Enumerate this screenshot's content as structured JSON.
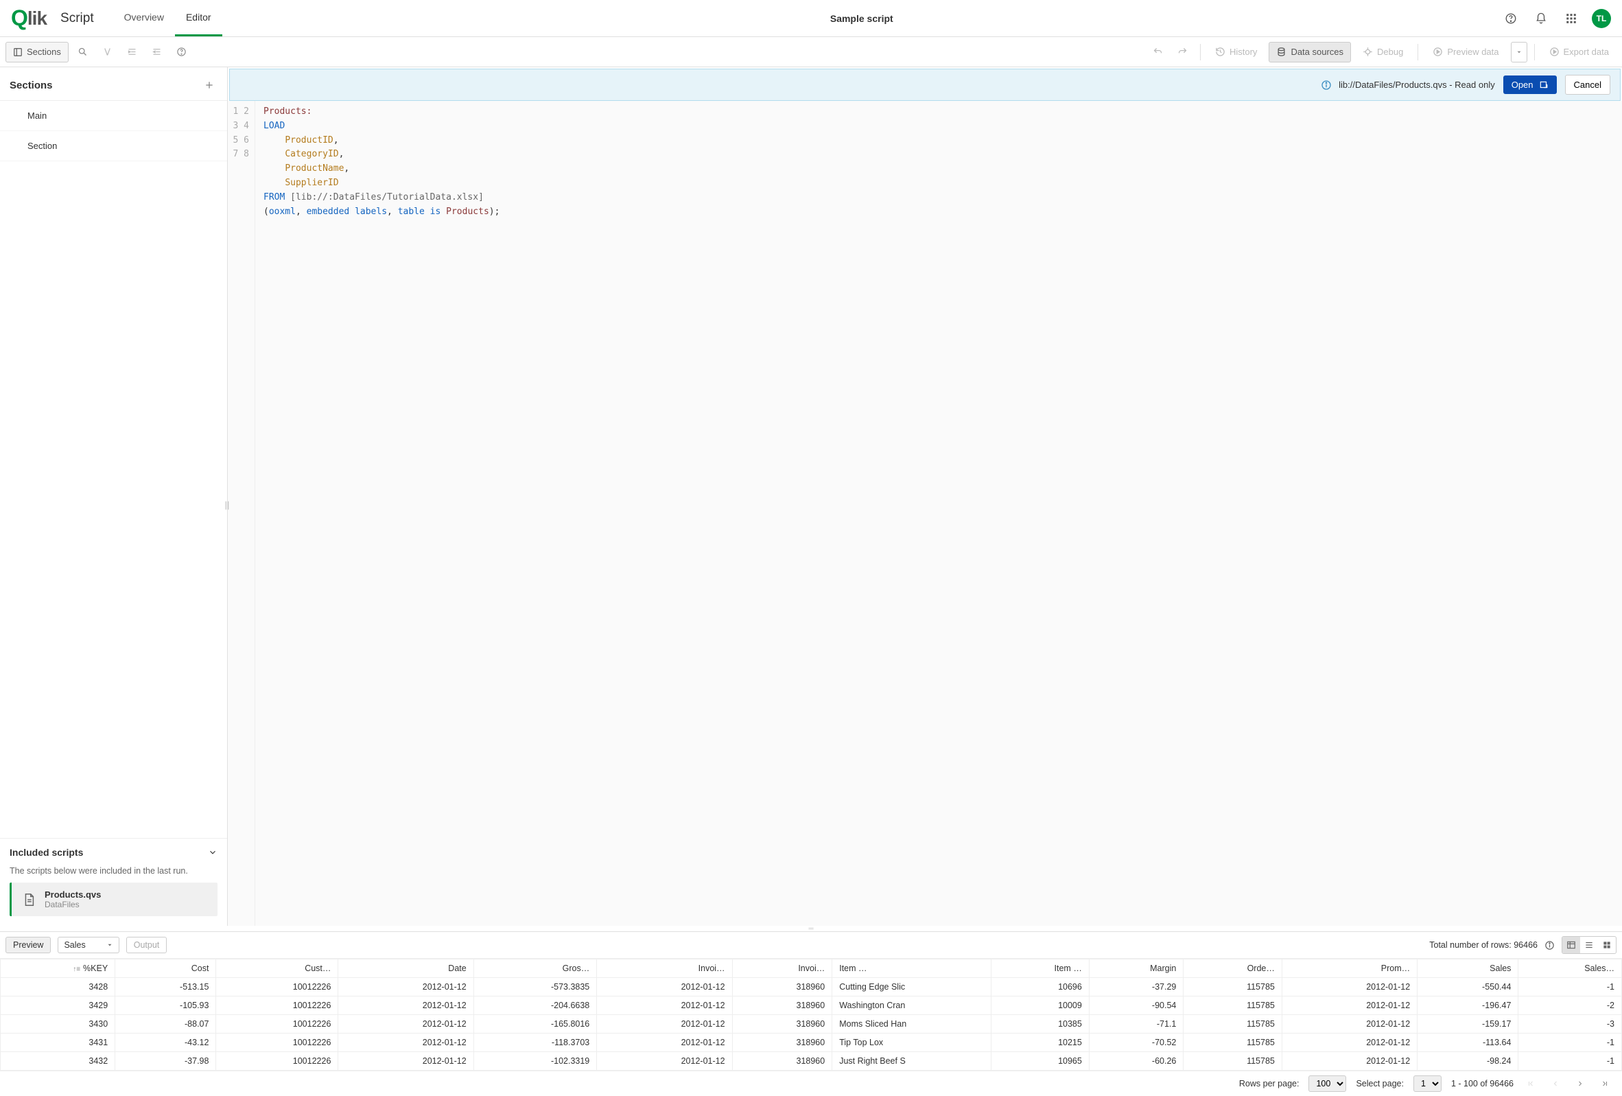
{
  "header": {
    "brand_prefix": "Q",
    "brand_rest": "lik",
    "script_label": "Script",
    "tabs": {
      "overview": "Overview",
      "editor": "Editor"
    },
    "title": "Sample script",
    "avatar": "TL"
  },
  "toolbar": {
    "sections": "Sections",
    "history": "History",
    "data_sources": "Data sources",
    "debug": "Debug",
    "preview_data": "Preview data",
    "export_data": "Export data"
  },
  "sidebar": {
    "title": "Sections",
    "items": [
      "Main",
      "Section"
    ],
    "included_title": "Included scripts",
    "included_desc": "The scripts below were included in the last run.",
    "script_name": "Products.qvs",
    "script_location": "DataFiles"
  },
  "notice": {
    "path": "lib://DataFiles/Products.qvs - Read only",
    "open": "Open",
    "cancel": "Cancel"
  },
  "code": {
    "lines": [
      "1",
      "2",
      "3",
      "4",
      "5",
      "6",
      "7",
      "8"
    ],
    "tbl": "Products:",
    "load": "LOAD",
    "f1": "ProductID",
    "f2": "CategoryID",
    "f3": "ProductName",
    "f4": "SupplierID",
    "from": "FROM",
    "path": "[lib://:DataFiles/TutorialData.xlsx]",
    "paren_open": "(",
    "ooxml": "ooxml",
    "embedded": "embedded",
    "labels": "labels",
    "table": "table",
    "is": "is",
    "products": "Products",
    "close": ");"
  },
  "preview": {
    "tab": "Preview",
    "dropdown": "Sales",
    "output": "Output",
    "total_label": "Total number of rows:",
    "total": "96466",
    "columns": [
      "%KEY",
      "Cost",
      "Cust…",
      "Date",
      "Gros…",
      "Invoi…",
      "Invoi…",
      "Item …",
      "Item …",
      "Margin",
      "Orde…",
      "Prom…",
      "Sales",
      "Sales…"
    ],
    "rows": [
      [
        "3428",
        "-513.15",
        "10012226",
        "2012-01-12",
        "-573.3835",
        "2012-01-12",
        "318960",
        "Cutting Edge Slic",
        "10696",
        "-37.29",
        "115785",
        "2012-01-12",
        "-550.44",
        "-1"
      ],
      [
        "3429",
        "-105.93",
        "10012226",
        "2012-01-12",
        "-204.6638",
        "2012-01-12",
        "318960",
        "Washington Cran",
        "10009",
        "-90.54",
        "115785",
        "2012-01-12",
        "-196.47",
        "-2"
      ],
      [
        "3430",
        "-88.07",
        "10012226",
        "2012-01-12",
        "-165.8016",
        "2012-01-12",
        "318960",
        "Moms Sliced Han",
        "10385",
        "-71.1",
        "115785",
        "2012-01-12",
        "-159.17",
        "-3"
      ],
      [
        "3431",
        "-43.12",
        "10012226",
        "2012-01-12",
        "-118.3703",
        "2012-01-12",
        "318960",
        "Tip Top Lox",
        "10215",
        "-70.52",
        "115785",
        "2012-01-12",
        "-113.64",
        "-1"
      ],
      [
        "3432",
        "-37.98",
        "10012226",
        "2012-01-12",
        "-102.3319",
        "2012-01-12",
        "318960",
        "Just Right Beef S",
        "10965",
        "-60.26",
        "115785",
        "2012-01-12",
        "-98.24",
        "-1"
      ]
    ]
  },
  "pager": {
    "rows_per_page_label": "Rows per page:",
    "rows_per_page": "100",
    "select_page_label": "Select page:",
    "select_page": "1",
    "range": "1 - 100 of 96466"
  }
}
